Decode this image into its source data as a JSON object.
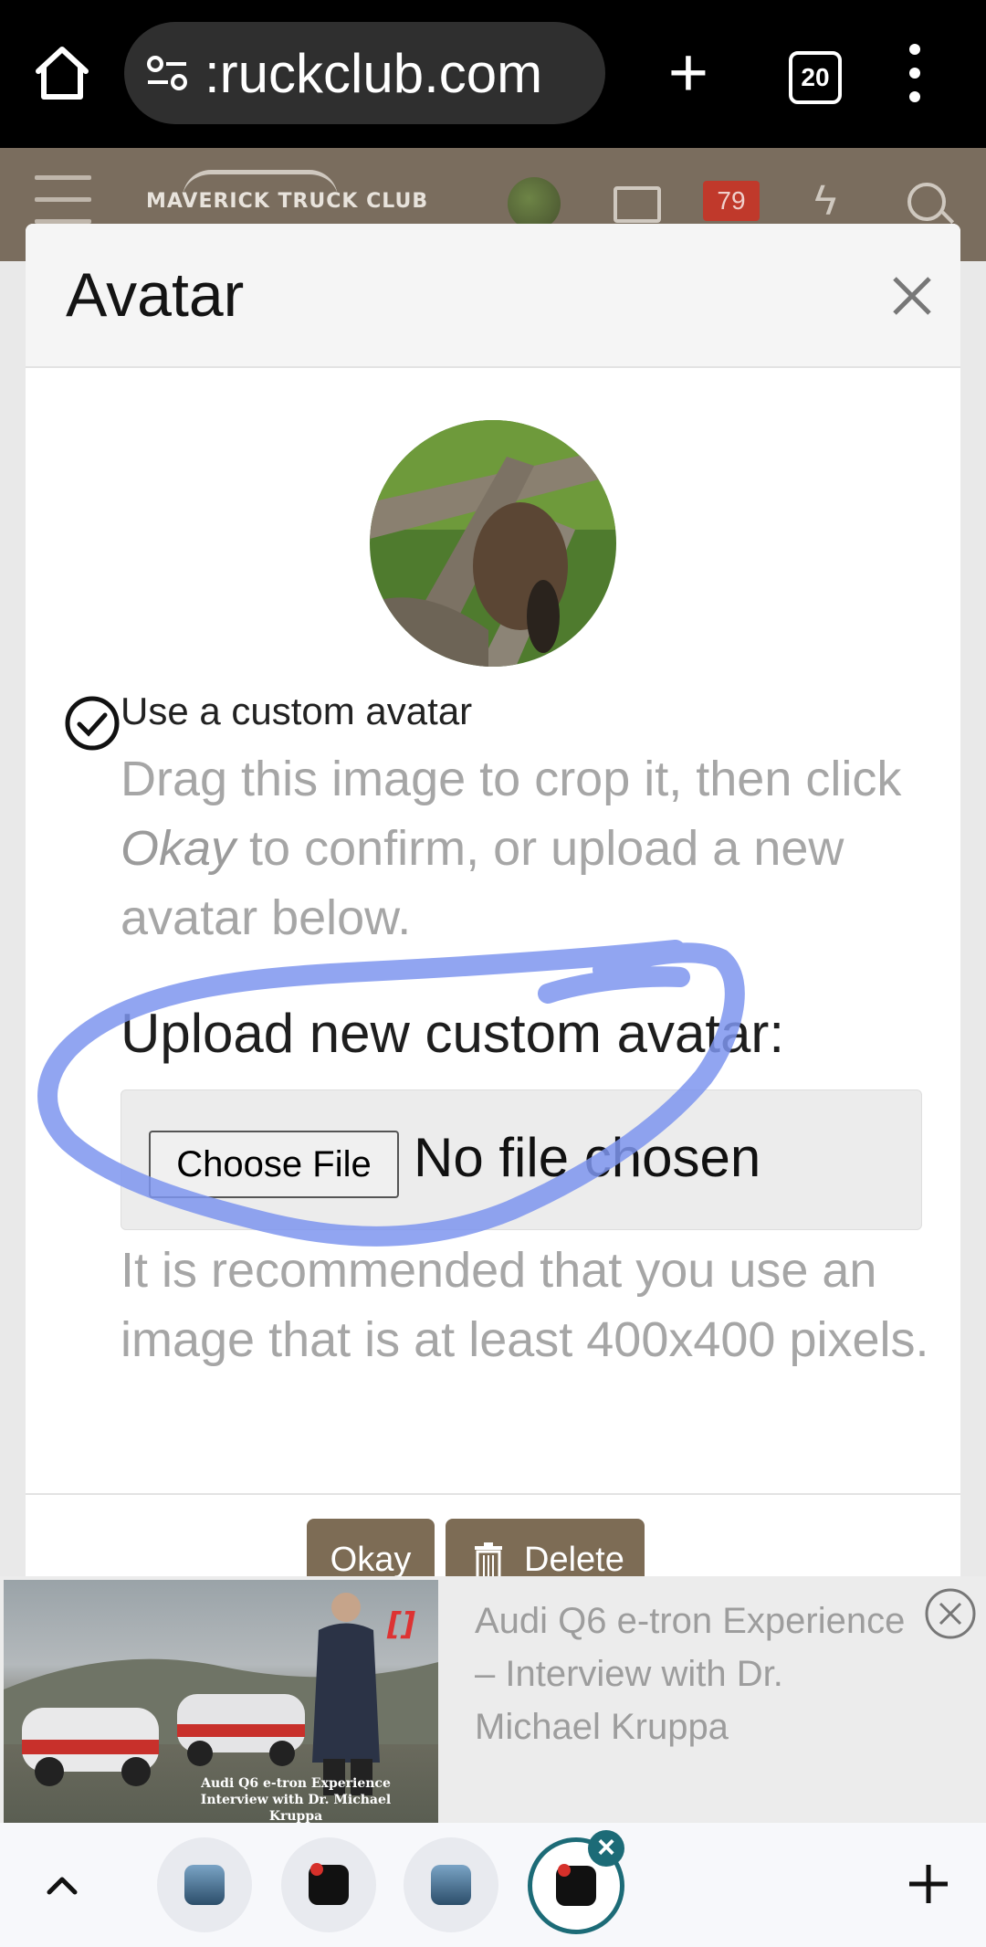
{
  "browser": {
    "url": ":ruckclub.com",
    "tab_count": "20"
  },
  "site_header": {
    "logo_text": "MAVERICK TRUCK CLUB",
    "notification_count": "79"
  },
  "modal": {
    "title": "Avatar",
    "custom_avatar_label": "Use a custom avatar",
    "hint_before": "Drag this image to crop it, then click ",
    "hint_emphasis": "Okay",
    "hint_after": " to confirm, or upload a new avatar below.",
    "upload_label": "Upload new custom avatar:",
    "choose_file_label": "Choose File",
    "file_status": "No file chosen",
    "recommendation": "It is recommended that you use an image that is at least 400x400 pixels.",
    "okay_label": "Okay",
    "delete_label": "Delete"
  },
  "ad": {
    "title": "Audi Q6 e-tron Experience – Interview with Dr. Michael Kruppa",
    "thumbnail_caption_1": "Audi Q6 e-tron Experience",
    "thumbnail_caption_2": "Interview with Dr. Michael Kruppa"
  },
  "tab_strip": {
    "tabs": [
      {
        "icon": "car-favicon"
      },
      {
        "icon": "mtc-favicon"
      },
      {
        "icon": "car-favicon"
      },
      {
        "icon": "mtc-favicon",
        "active": true
      }
    ]
  },
  "colors": {
    "modal_button": "#7d6c55",
    "annotation_stroke": "#7e95ee",
    "active_tab_ring": "#1c6b77"
  }
}
